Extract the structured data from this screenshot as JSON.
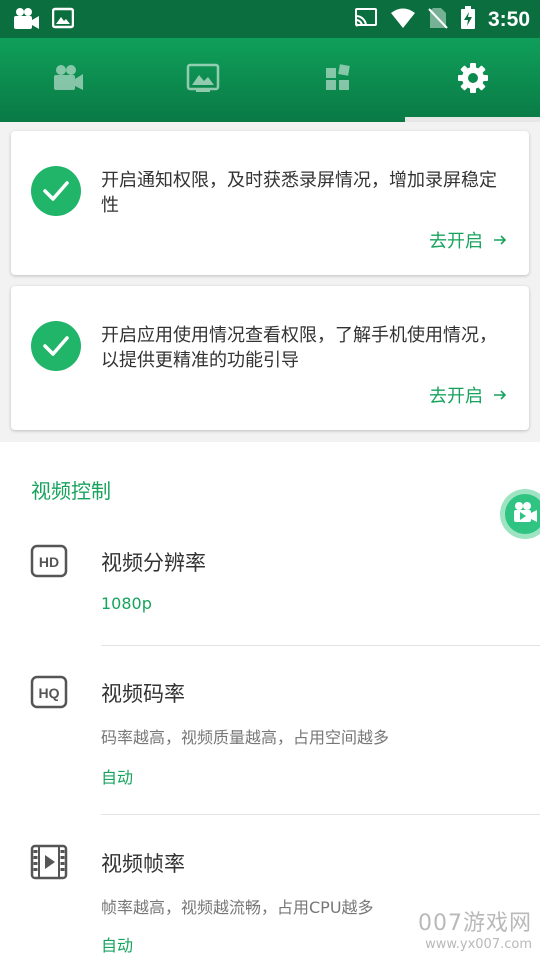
{
  "status_bar": {
    "time": "3:50",
    "icons": [
      "video-camera-icon",
      "image-icon",
      "cast-icon",
      "wifi-icon",
      "no-sim-icon",
      "battery-charging-icon"
    ]
  },
  "tabs": [
    {
      "icon": "video-camera-icon",
      "selected": false
    },
    {
      "icon": "gallery-icon",
      "selected": false
    },
    {
      "icon": "grid-tools-icon",
      "selected": false
    },
    {
      "icon": "gear-icon",
      "selected": true
    }
  ],
  "permission_cards": [
    {
      "message": "开启通知权限，及时获悉录屏情况，增加录屏稳定性",
      "action": "去开启"
    },
    {
      "message": "开启应用使用情况查看权限，了解手机使用情况，以提供更精准的功能引导",
      "action": "去开启"
    }
  ],
  "video_control": {
    "section_title": "视频控制",
    "items": [
      {
        "icon": "hd-icon",
        "icon_text": "HD",
        "title": "视频分辨率",
        "description": "",
        "value": "1080p"
      },
      {
        "icon": "hq-icon",
        "icon_text": "HQ",
        "title": "视频码率",
        "description": "码率越高，视频质量越高，占用空间越多",
        "value": "自动"
      },
      {
        "icon": "film-icon",
        "icon_text": "",
        "title": "视频帧率",
        "description": "帧率越高，视频越流畅，占用CPU越多",
        "value": "自动"
      }
    ]
  },
  "watermark": {
    "line1": "007游戏网",
    "line2": "www.yx007.com"
  },
  "colors": {
    "primary": "#0f9f5a",
    "accent": "#17a35e",
    "status_bar": "#0a6e3e"
  }
}
